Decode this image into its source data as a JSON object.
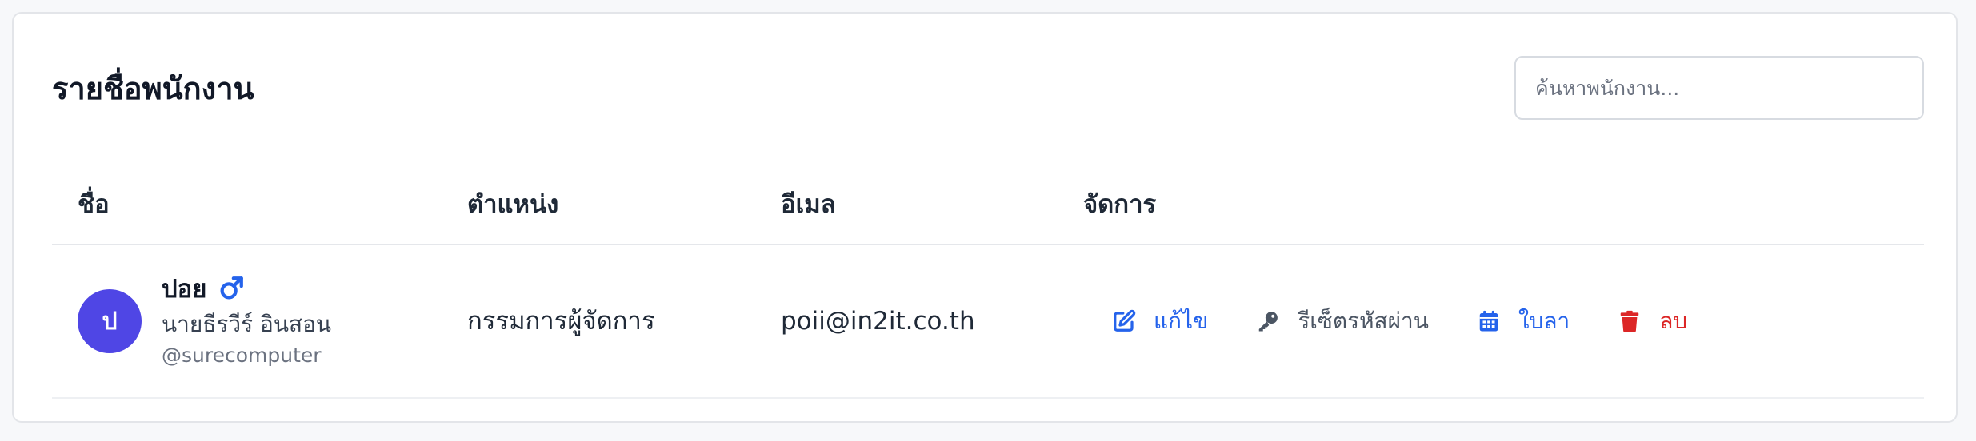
{
  "header": {
    "title": "รายชื่อพนักงาน",
    "search_placeholder": "ค้นหาพนักงาน..."
  },
  "table": {
    "columns": [
      "ชื่อ",
      "ตำแหน่ง",
      "อีเมล",
      "จัดการ"
    ],
    "rows": [
      {
        "avatar_initial": "ป",
        "nickname": "ปอย",
        "gender_icon": "male-icon",
        "full_name": "นายธีรวีร์ อินสอน",
        "username": "@surecomputer",
        "position": "กรรมการผู้จัดการ",
        "email": "poii@in2it.co.th",
        "actions": {
          "edit": "แก้ไข",
          "reset_password": "รีเซ็ตรหัสผ่าน",
          "leave": "ใบลา",
          "delete": "ลบ"
        }
      }
    ]
  },
  "colors": {
    "avatar": "#4f46e5",
    "edit": "#2563eb",
    "reset": "#4b5563",
    "leave": "#2563eb",
    "delete": "#dc2626",
    "gender_male": "#2563eb"
  }
}
